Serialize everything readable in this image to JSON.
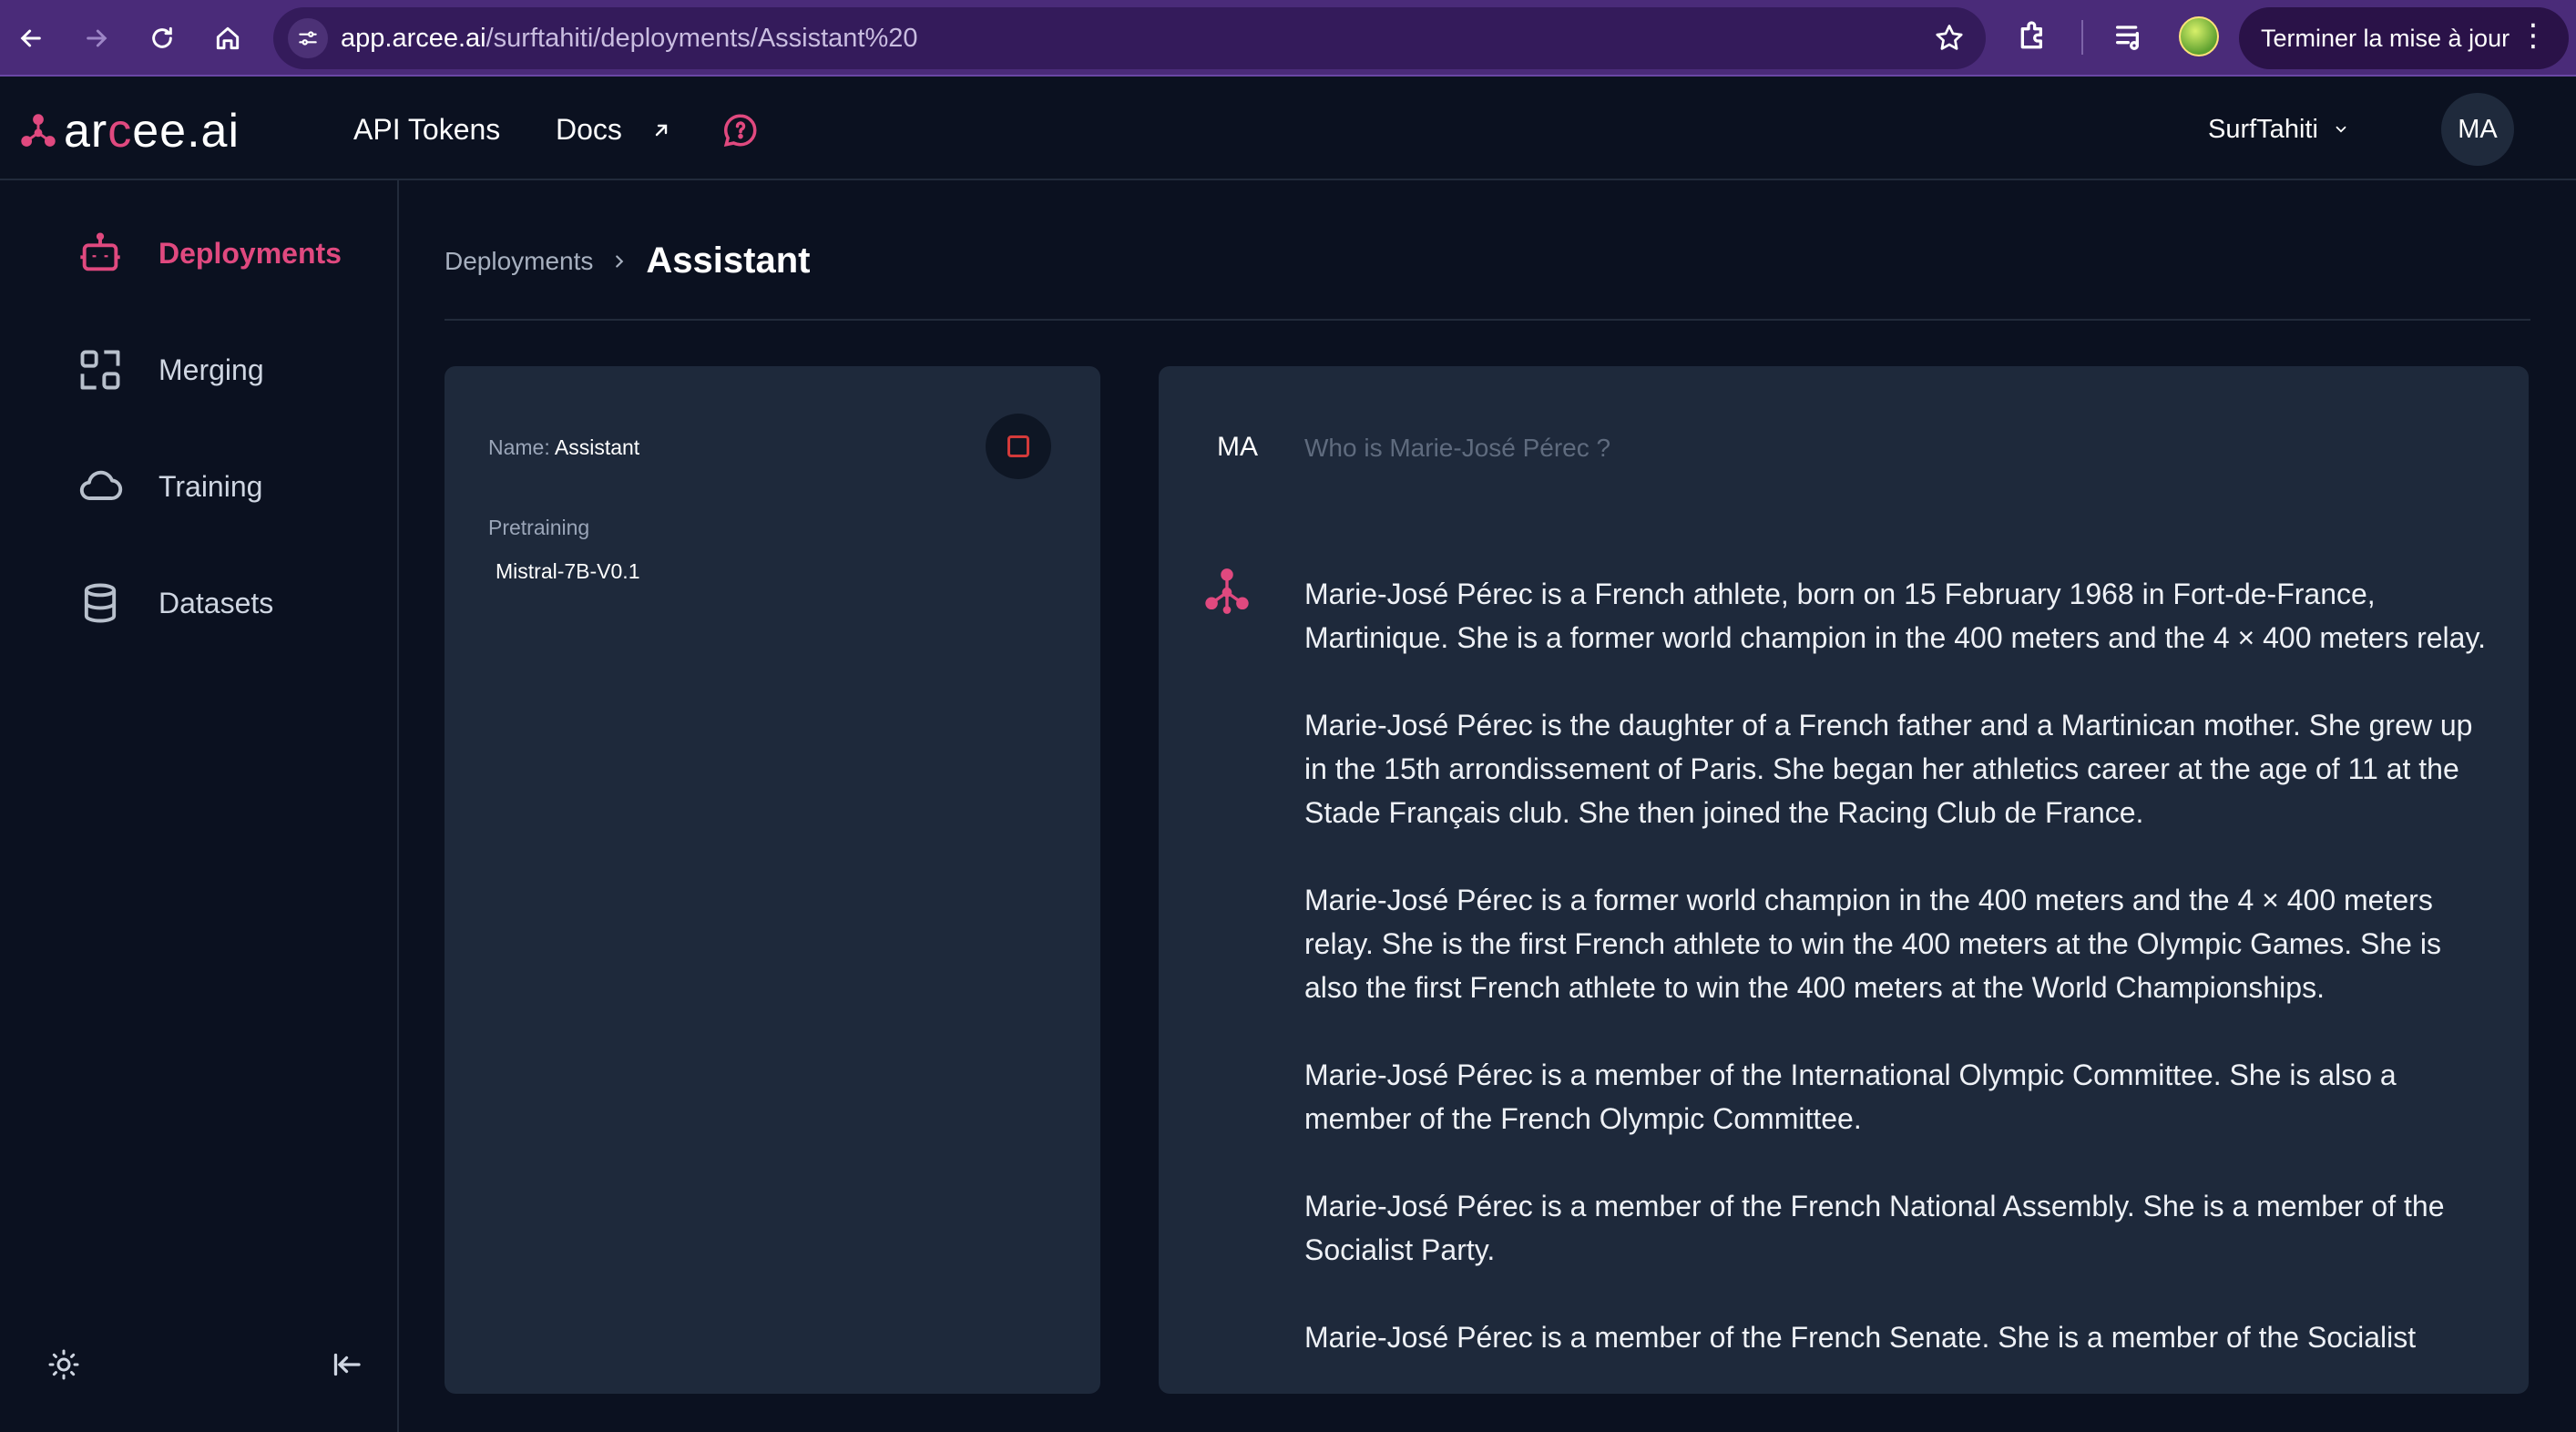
{
  "browser": {
    "url_host": "app.arcee.ai",
    "url_path": "/surftahiti/deployments/Assistant%20",
    "update_label": "Terminer la mise à jour",
    "icons": [
      "back-icon",
      "forward-icon",
      "reload-icon",
      "home-icon",
      "site-settings-icon",
      "star-icon",
      "extensions-icon",
      "media-icon",
      "profile-icon",
      "more-icon"
    ]
  },
  "header": {
    "logo_part1": "ar",
    "logo_part2": "c",
    "logo_part3": "ee.ai",
    "api_tokens": "API Tokens",
    "docs": "Docs",
    "workspace": "SurfTahiti",
    "avatar_initials": "MA"
  },
  "sidebar": {
    "items": [
      {
        "label": "Deployments",
        "icon": "robot-icon",
        "active": true
      },
      {
        "label": "Merging",
        "icon": "merge-icon",
        "active": false
      },
      {
        "label": "Training",
        "icon": "cloud-icon",
        "active": false
      },
      {
        "label": "Datasets",
        "icon": "database-icon",
        "active": false
      }
    ]
  },
  "breadcrumb": {
    "parent": "Deployments",
    "current": "Assistant"
  },
  "info": {
    "name_label": "Name:",
    "name_value": "Assistant",
    "pretraining_label": "Pretraining",
    "pretraining_value": "Mistral-7B-V0.1"
  },
  "chat": {
    "user_initials": "MA",
    "prompt": "Who is Marie-José Pérec ?",
    "response": [
      "Marie-José Pérec is a French athlete, born on 15 February 1968 in Fort-de-France, Martinique. She is a former world champion in the 400 meters and the 4 × 400 meters relay.",
      "Marie-José Pérec is the daughter of a French father and a Martinican mother. She grew up in the 15th arrondissement of Paris. She began her athletics career at the age of 11 at the Stade Français club. She then joined the Racing Club de France.",
      "Marie-José Pérec is a former world champion in the 400 meters and the 4 × 400 meters relay. She is the first French athlete to win the 400 meters at the Olympic Games. She is also the first French athlete to win the 400 meters at the World Championships.",
      "Marie-José Pérec is a member of the International Olympic Committee. She is also a member of the French Olympic Committee.",
      "Marie-José Pérec is a member of the French National Assembly. She is a member of the Socialist Party.",
      "Marie-José Pérec is a member of the French Senate. She is a member of the Socialist"
    ]
  },
  "colors": {
    "accent": "#e0497f",
    "background": "#0b1120",
    "card": "#1e293b",
    "browser_bar": "#4a2b79"
  }
}
